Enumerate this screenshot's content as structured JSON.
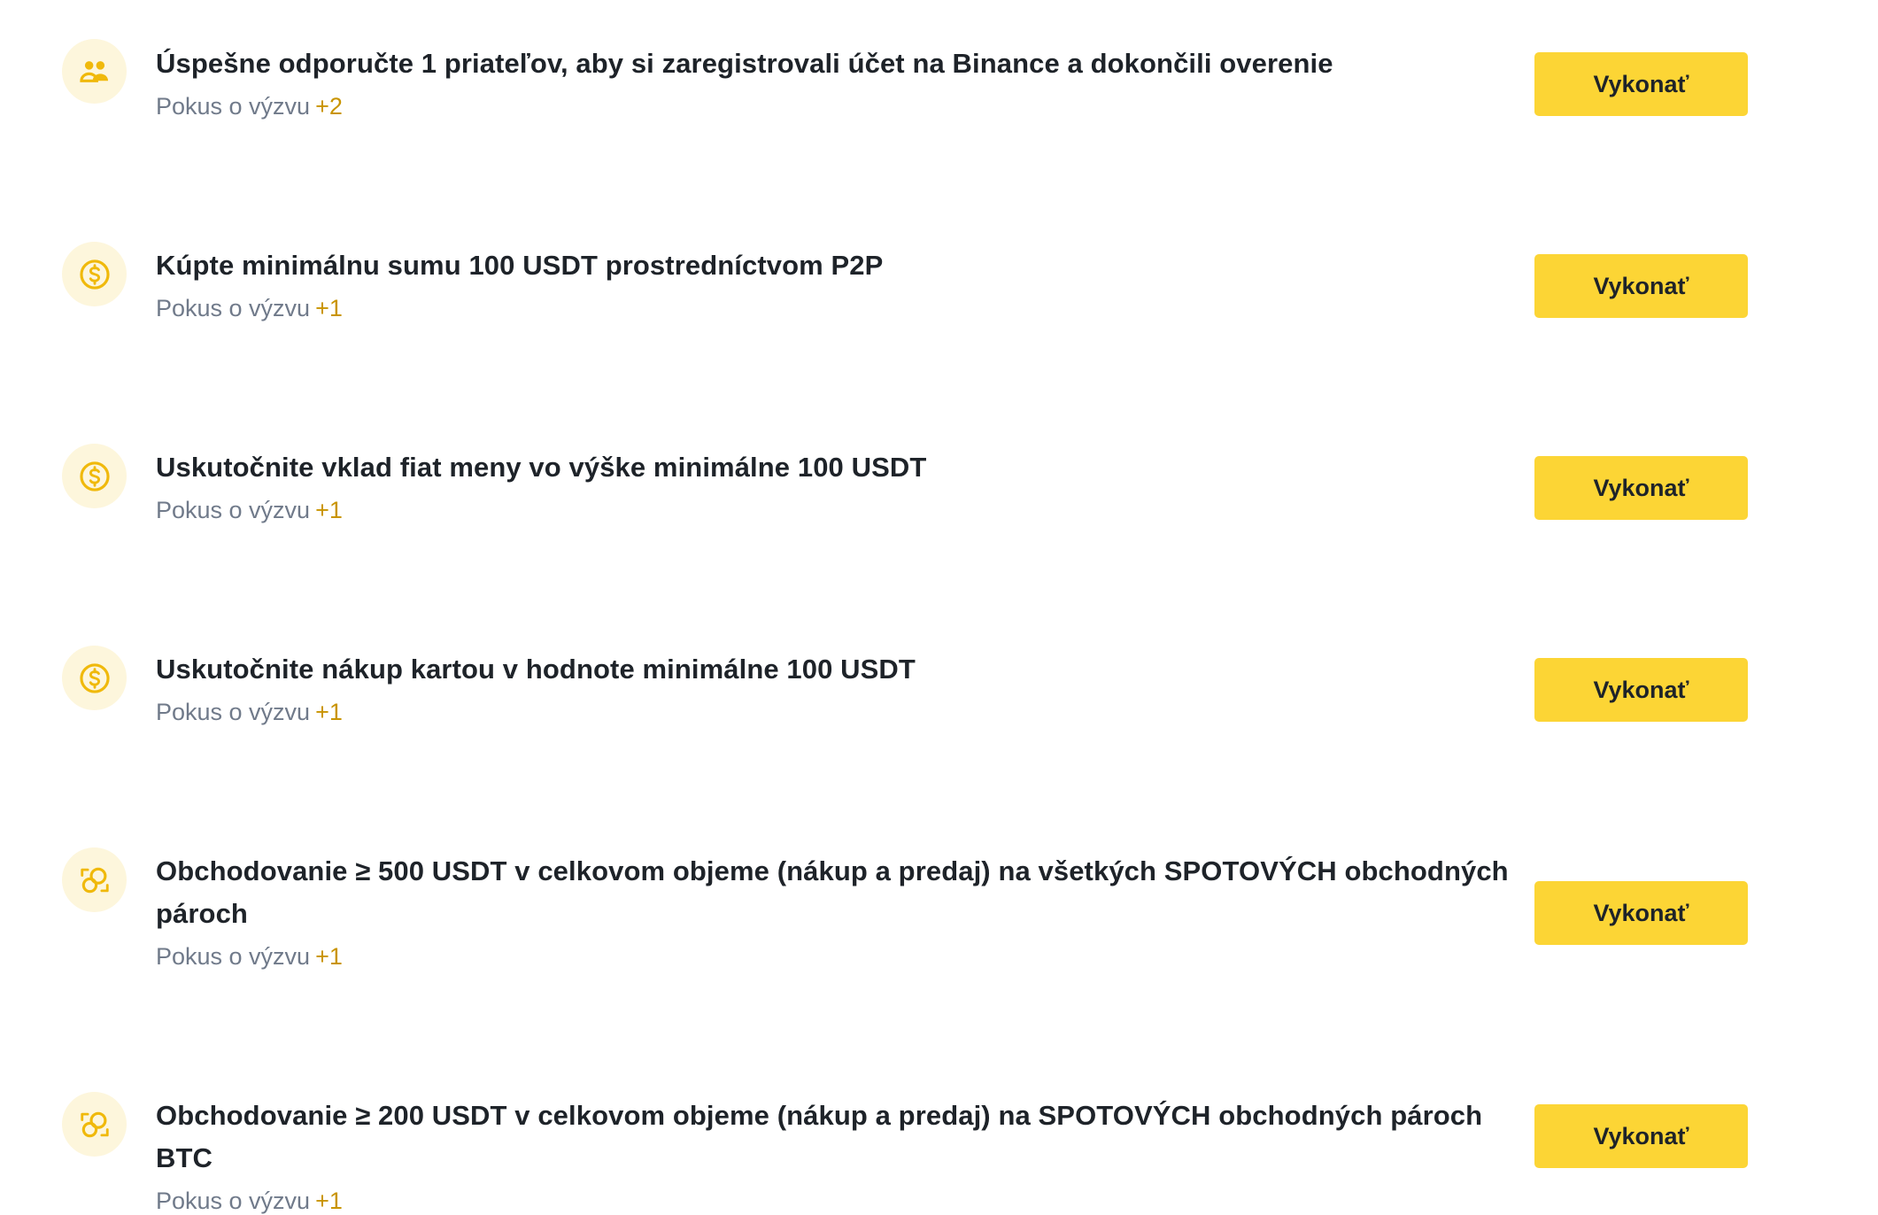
{
  "colors": {
    "accent": "#fcd535",
    "icon_bg": "#fdf6dc",
    "icon_fg": "#f0b90b",
    "points": "#c99400",
    "title": "#1e2329",
    "subtitle": "#707a8a"
  },
  "tasks": [
    {
      "icon": "users-icon",
      "title": "Úspešne odporučte 1 priateľov, aby si zaregistrovali účet na Binance a dokončili overenie",
      "subtitle": "Pokus o výzvu",
      "points": "+2",
      "button": "Vykonať"
    },
    {
      "icon": "dollar-coin-icon",
      "title": "Kúpte minimálnu sumu 100 USDT prostredníctvom P2P",
      "subtitle": "Pokus o výzvu",
      "points": "+1",
      "button": "Vykonať"
    },
    {
      "icon": "dollar-coin-icon",
      "title": "Uskutočnite vklad fiat meny vo výške minimálne 100 USDT",
      "subtitle": "Pokus o výzvu",
      "points": "+1",
      "button": "Vykonať"
    },
    {
      "icon": "dollar-coin-icon",
      "title": "Uskutočnite nákup kartou v hodnote minimálne 100 USDT",
      "subtitle": "Pokus o výzvu",
      "points": "+1",
      "button": "Vykonať"
    },
    {
      "icon": "trade-exchange-icon",
      "title": "Obchodovanie ≥ 500 USDT v celkovom objeme (nákup a predaj) na všetkých SPOTOVÝCH obchodných pároch",
      "subtitle": "Pokus o výzvu",
      "points": "+1",
      "button": "Vykonať"
    },
    {
      "icon": "trade-exchange-icon",
      "title": "Obchodovanie ≥ 200 USDT v celkovom objeme (nákup a predaj) na SPOTOVÝCH obchodných pároch BTC",
      "subtitle": "Pokus o výzvu",
      "points": "+1",
      "button": "Vykonať"
    }
  ]
}
